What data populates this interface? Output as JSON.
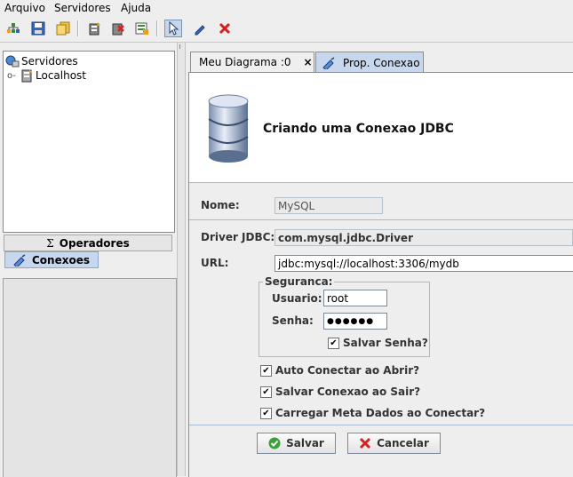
{
  "menu": {
    "arquivo": "Arquivo",
    "servidores": "Servidores",
    "ajuda": "Ajuda"
  },
  "tree": {
    "root": "Servidores",
    "child": "Localhost"
  },
  "left_tabs": {
    "operadores": "Operadores",
    "conexoes": "Conexoes"
  },
  "tabs": {
    "diagram": "Meu Diagrama :0",
    "close_glyph": "×",
    "prop": "Prop. Conexao"
  },
  "header": {
    "title": "Criando uma Conexao JDBC"
  },
  "form": {
    "nome_label": "Nome:",
    "nome_value": "MySQL",
    "driver_label": "Driver JDBC:",
    "driver_value": "com.mysql.jdbc.Driver",
    "url_label": "URL:",
    "url_value": "jdbc:mysql://localhost:3306/mydb",
    "seguranca_label": "Seguranca:",
    "usuario_label": "Usuario:",
    "usuario_value": "root",
    "senha_label": "Senha:",
    "senha_value": "●●●●●●",
    "salvar_senha": "Salvar Senha?",
    "auto_conectar": "Auto Conectar ao Abrir?",
    "salvar_conexao": "Salvar Conexao ao Sair?",
    "carregar_meta": "Carregar Meta Dados ao Conectar?"
  },
  "buttons": {
    "salvar": "Salvar",
    "cancelar": "Cancelar"
  },
  "checkbox_mark": "✔",
  "colors": {
    "accent_tab": "#c6d7ee",
    "selected_tool": "#c9d6e6",
    "save_green": "#3aa13a",
    "cancel_red": "#d42020"
  }
}
